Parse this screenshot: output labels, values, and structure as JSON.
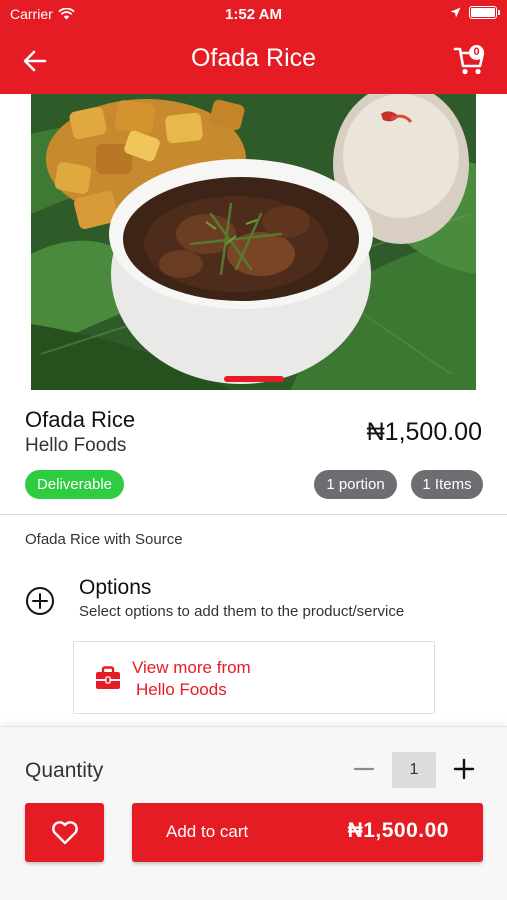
{
  "status_bar": {
    "carrier": "Carrier",
    "time": "1:52 AM",
    "icons": [
      "wifi-icon",
      "location-arrow-icon",
      "battery-icon"
    ]
  },
  "nav": {
    "title": "Ofada Rice",
    "back_icon": "arrow-left-icon",
    "cart_icon": "cart-icon",
    "cart_count": "0"
  },
  "colors": {
    "brand_red": "#e51c23",
    "deliverable_green": "#2ecc40",
    "badge_gray": "#6d6d72"
  },
  "product": {
    "name": "Ofada Rice",
    "vendor": "Hello Foods",
    "price": "₦1,500.00",
    "badges": {
      "deliverable": "Deliverable",
      "portion": "1 portion",
      "items": "1 Items"
    },
    "description": "Ofada Rice with Source"
  },
  "options": {
    "title": "Options",
    "subtitle": "Select options to add them to the product/service"
  },
  "view_more": {
    "line1": "View more from",
    "line2": "Hello Foods"
  },
  "quantity": {
    "label": "Quantity",
    "value": "1"
  },
  "add_to_cart": {
    "label": "Add to cart",
    "price": "₦1,500.00"
  }
}
